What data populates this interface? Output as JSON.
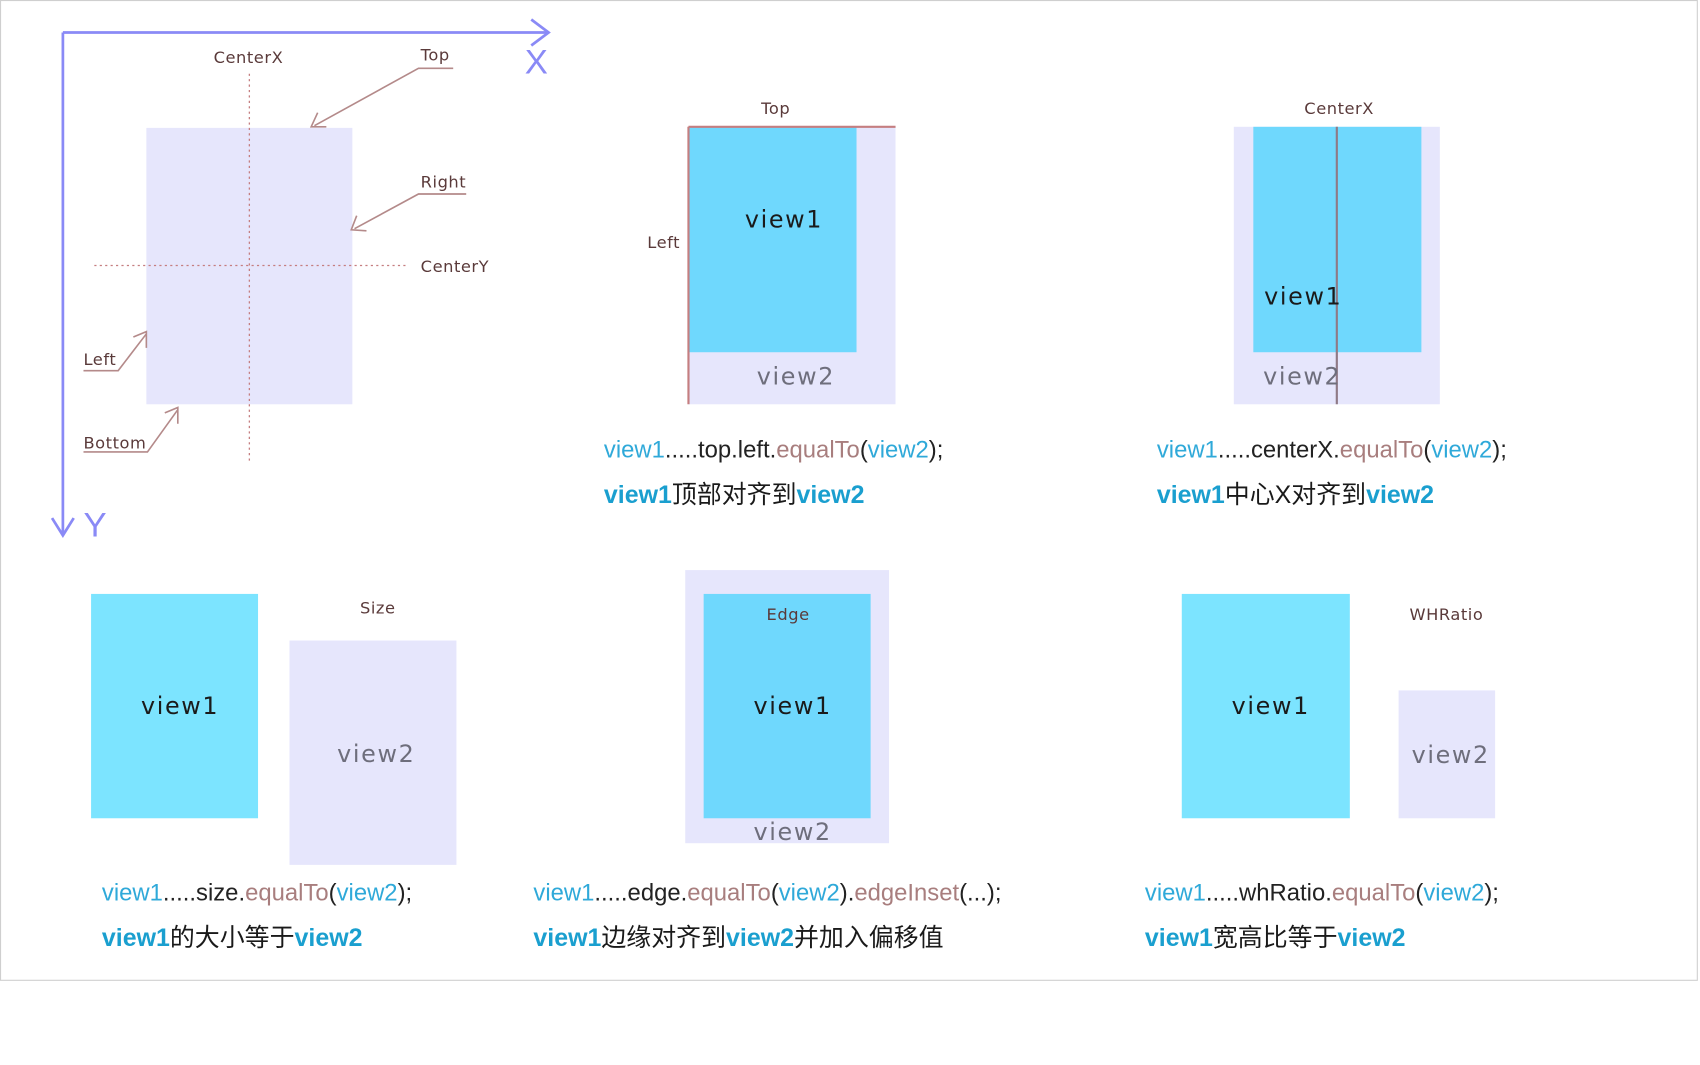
{
  "axes": {
    "x": "X",
    "y": "Y"
  },
  "overview": {
    "labels": {
      "centerx": "CenterX",
      "top": "Top",
      "right": "Right",
      "centery": "CenterY",
      "left": "Left",
      "bottom": "Bottom"
    }
  },
  "panels": {
    "top": {
      "title": "Top",
      "side_label": "Left",
      "view1": "view1",
      "view2": "view2"
    },
    "centerx": {
      "title": "CenterX",
      "view1": "view1",
      "view2": "view2"
    },
    "size": {
      "title": "Size",
      "view1": "view1",
      "view2": "view2"
    },
    "edge": {
      "title": "Edge",
      "view1": "view1",
      "view2": "view2"
    },
    "whratio": {
      "title": "WHRatio",
      "view1": "view1",
      "view2": "view2"
    }
  },
  "captions": {
    "top": {
      "code": [
        "view1",
        ".....top.left.",
        "equalTo",
        "(",
        "view2",
        ");"
      ],
      "desc": [
        "view1",
        "顶部对齐到",
        "view2"
      ]
    },
    "centerx": {
      "code": [
        "view1",
        ".....centerX.",
        "equalTo",
        "(",
        "view2",
        ");"
      ],
      "desc": [
        "view1",
        "中心X对齐到",
        "view2"
      ]
    },
    "size": {
      "code": [
        "view1",
        ".....size.",
        "equalTo",
        "(",
        "view2",
        ");"
      ],
      "desc": [
        "view1",
        "的大小等于",
        "view2"
      ]
    },
    "edge": {
      "code": [
        "view1",
        ".....edge.",
        "equalTo",
        "(",
        "view2",
        ").",
        "edgeInset",
        "(...);"
      ],
      "desc": [
        "view1",
        "边缘对齐到",
        "view2",
        "并加入偏移值"
      ]
    },
    "whratio": {
      "code": [
        "view1",
        ".....whRatio.",
        "equalTo",
        "(",
        "view2",
        ");"
      ],
      "desc": [
        "view1",
        "宽高比等于",
        "view2"
      ]
    }
  },
  "colors": {
    "view1": "#7ce4ff",
    "view2": "#e6e6fc",
    "axis": "#8a8af6",
    "arrow": "#b48a8a",
    "guide": "#c57e80",
    "code_blue": "#2fa9d9",
    "code_brown": "#a87e7e"
  }
}
